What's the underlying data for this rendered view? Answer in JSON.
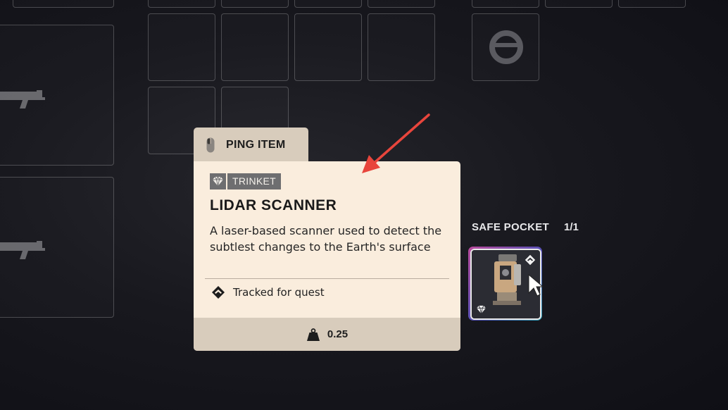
{
  "ping": {
    "label": "PING ITEM",
    "icon": "mouse-icon"
  },
  "item": {
    "category": "TRINKET",
    "category_icon": "diamond-gem-icon",
    "name": "LIDAR SCANNER",
    "description": "A laser-based scanner used to detect the subtlest changes to the Earth's surface",
    "quest_status": "Tracked for quest",
    "quest_icon": "quest-diamond-icon",
    "weight": "0.25",
    "weight_icon": "weight-icon"
  },
  "safe_pocket": {
    "label": "SAFE POCKET",
    "count": "1/1"
  },
  "colors": {
    "card_bg": "#faeddd",
    "footer_bg": "#d8ccbc",
    "badge_bg": "#6e6e70",
    "annotation_arrow": "#e8453c"
  }
}
